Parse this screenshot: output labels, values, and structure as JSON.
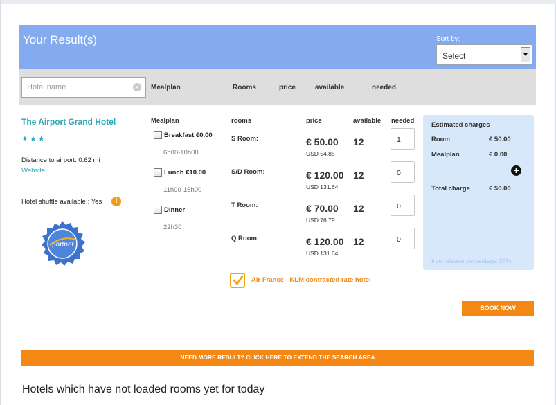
{
  "header": {
    "title": "Your Result(s)",
    "sort_label": "Sort by:",
    "sort_value": "Select"
  },
  "filter_bar": {
    "hotel_placeholder": "Hotel name",
    "columns": [
      "Mealplan",
      "Rooms",
      "price",
      "available",
      "needed"
    ]
  },
  "hotel": {
    "name": "The Airport Grand Hotel",
    "stars_text": "★★★",
    "distance": "Distance to airport: 0.62 mi",
    "website": "Website",
    "shuttle": "Hotel shuttle available : Yes",
    "partner_badge": "partner"
  },
  "table_headers": {
    "mealplan": "Mealplan",
    "rooms": "rooms",
    "price": "price",
    "available": "available",
    "needed": "needed"
  },
  "meals": [
    {
      "label": "Breakfast €0.00",
      "time": "6h00-10h00"
    },
    {
      "label": "Lunch €10.00",
      "time": "11h00-15h00"
    },
    {
      "label": "Dinner",
      "time": "22h30"
    }
  ],
  "rooms": [
    {
      "type": "S Room:",
      "price": "€ 50.00",
      "usd": "USD 54.85",
      "available": "12",
      "needed": "1"
    },
    {
      "type": "S/D Room:",
      "price": "€ 120.00",
      "usd": "USD 131.64",
      "available": "12",
      "needed": "0"
    },
    {
      "type": "T Room:",
      "price": "€ 70.00",
      "usd": "USD 76.79",
      "available": "12",
      "needed": "0"
    },
    {
      "type": "Q Room:",
      "price": "€ 120.00",
      "usd": "USD 131.64",
      "available": "12",
      "needed": "0"
    }
  ],
  "estimate": {
    "title": "Estimated charges",
    "room_label": "Room",
    "room_value": "€ 50.00",
    "meal_label": "Mealplan",
    "meal_value": "€ 0.00",
    "total_label": "Total charge",
    "total_value": "€ 50.00",
    "free_release": "free release percentage 25%"
  },
  "contracted_rate": "Air France - KLM contracted rate hotel",
  "book_now": "BOOK NOW",
  "more_results": "NEED MORE RESULT? CLICK HERE TO EXTEND THE SEARCH AREA",
  "not_loaded_title": "Hotels which have not loaded rooms yet for today",
  "colors": {
    "header_bg": "#84abf0",
    "accent_teal": "#2aa8b6",
    "orange": "#f58714",
    "estimate_bg": "#d8e8fb"
  }
}
